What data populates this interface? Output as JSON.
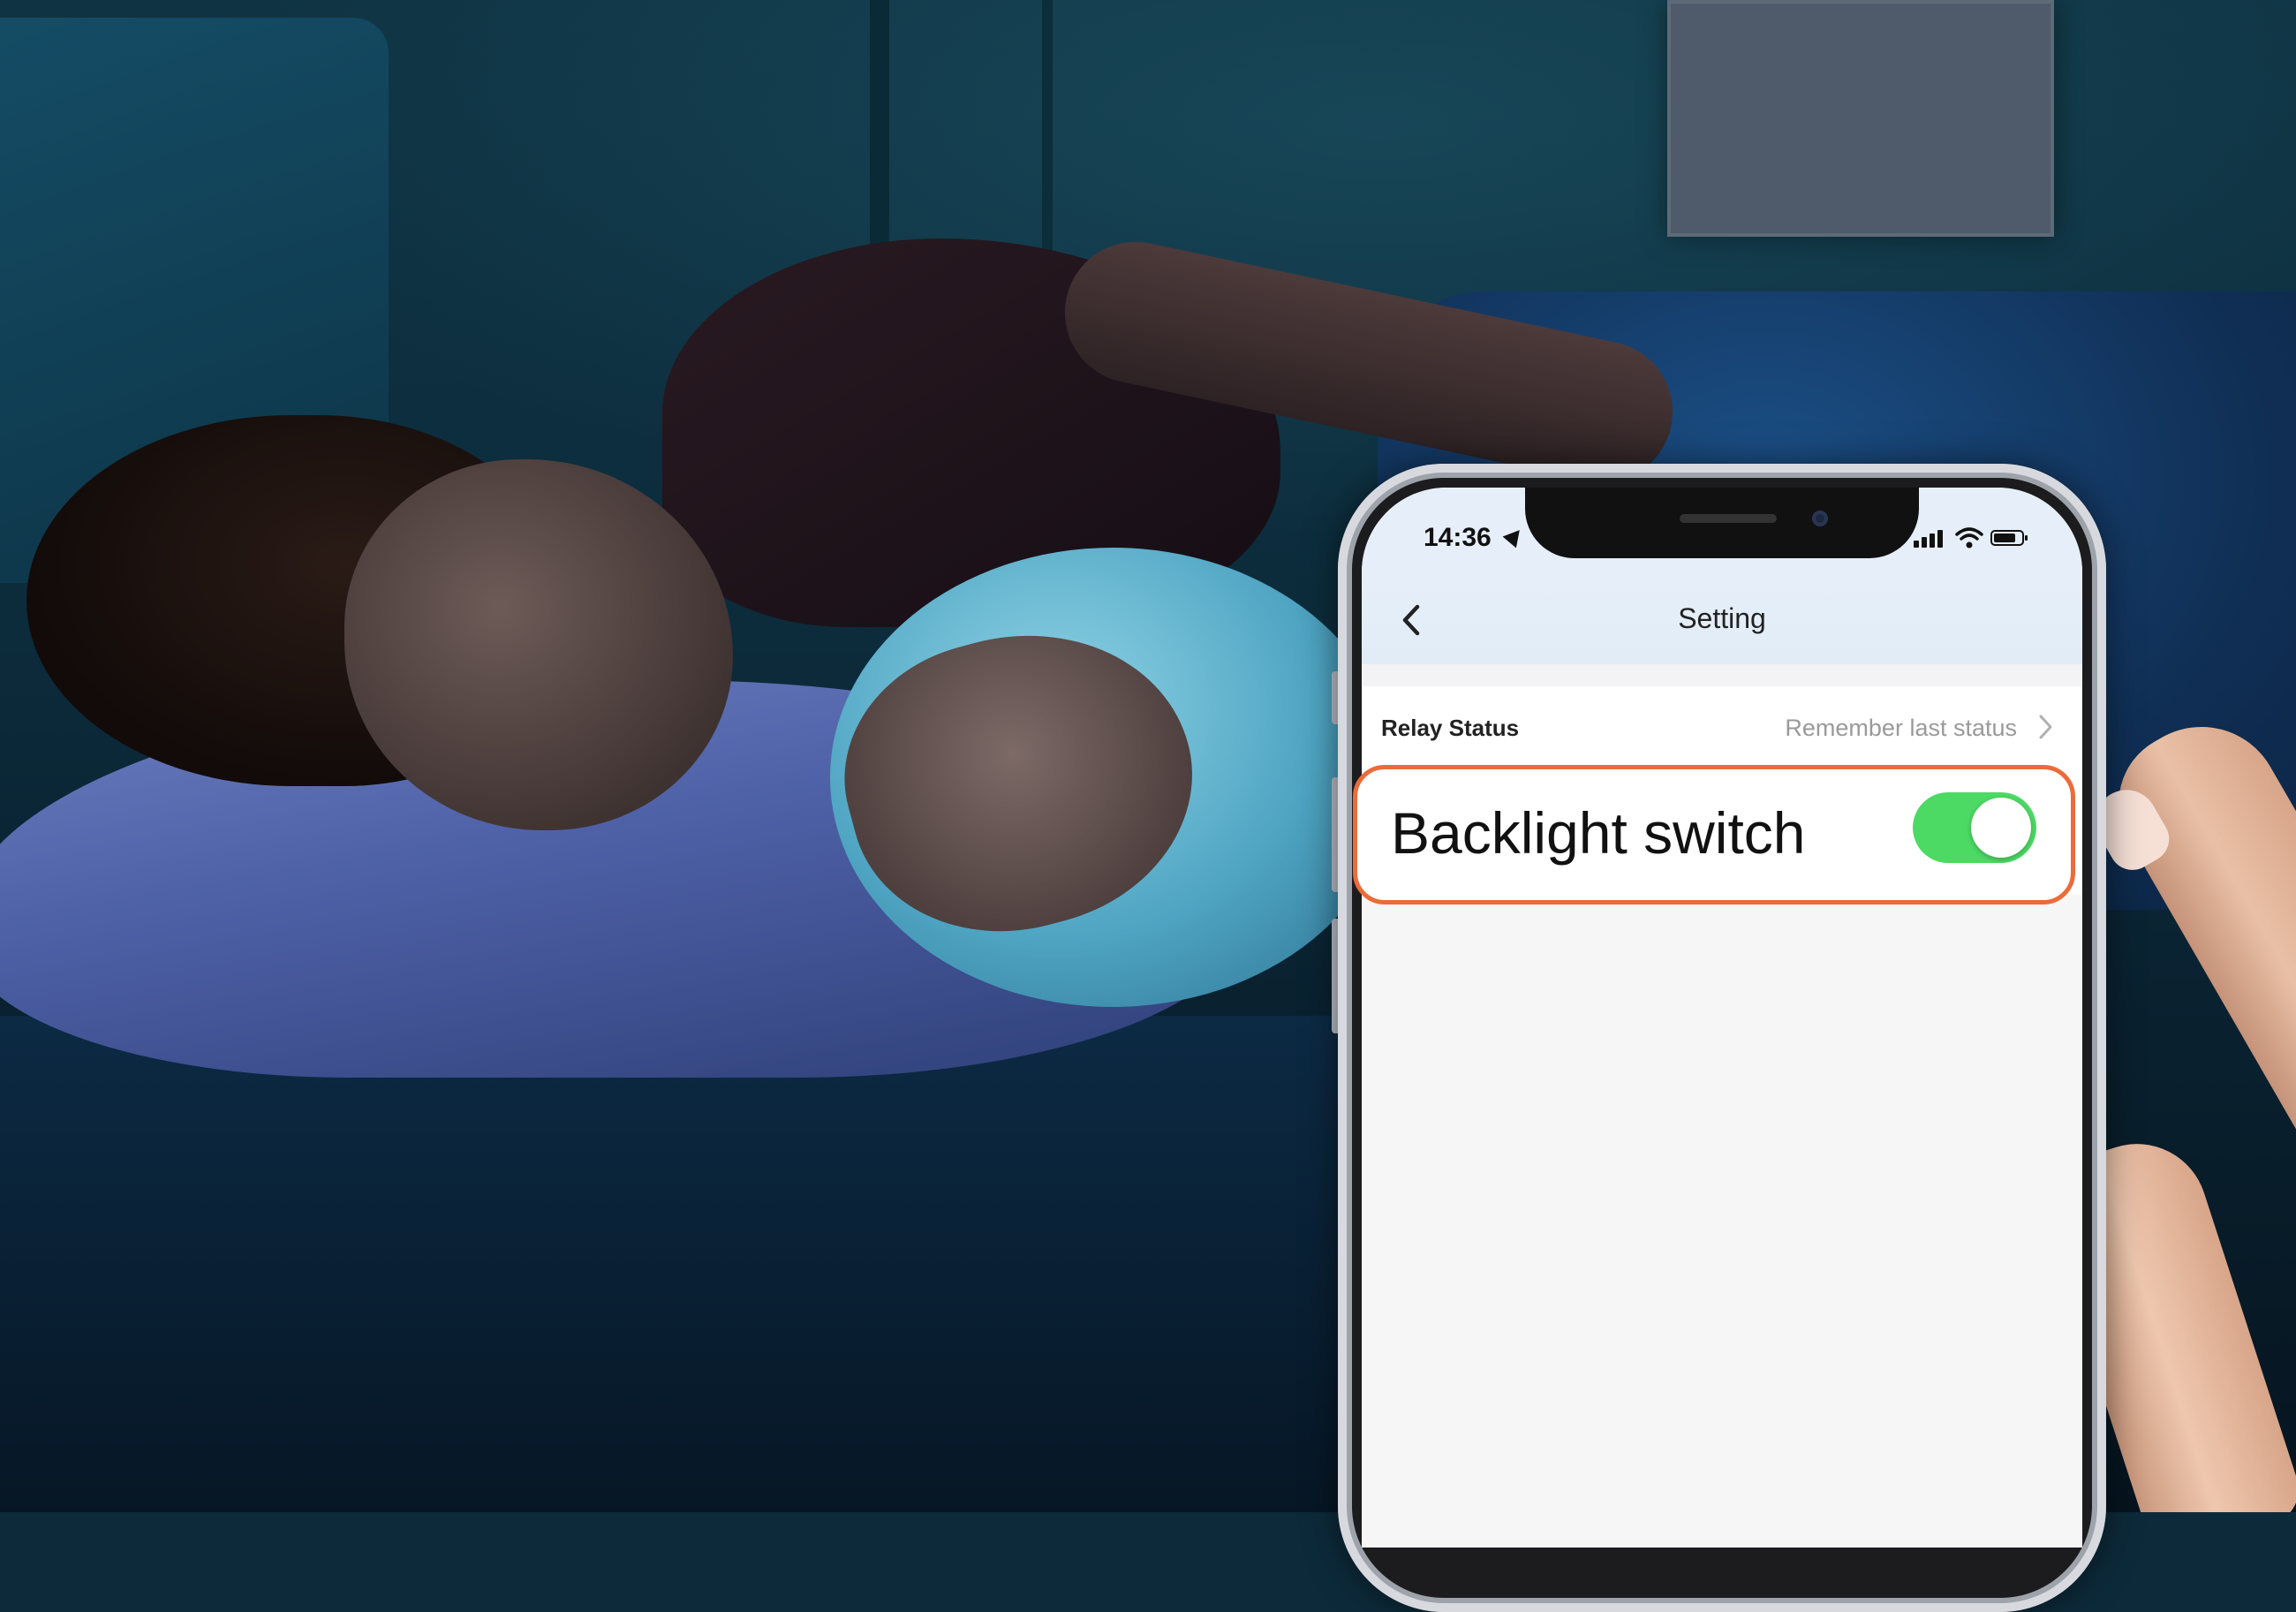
{
  "status_bar": {
    "time": "14:36",
    "icons": [
      "location-icon",
      "signal-icon",
      "wifi-icon",
      "battery-icon"
    ]
  },
  "nav": {
    "title": "Setting",
    "back_icon": "chevron-left-icon"
  },
  "settings": {
    "relay_status": {
      "label": "Relay Status",
      "value": "Remember last status",
      "icon": "chevron-right-icon"
    },
    "backlight_switch": {
      "label": "Backlight switch",
      "enabled": true
    }
  },
  "colors": {
    "toggle_on": "#4cd964",
    "highlight_border": "#ec6b3a",
    "nav_background": "#e6eff9"
  }
}
